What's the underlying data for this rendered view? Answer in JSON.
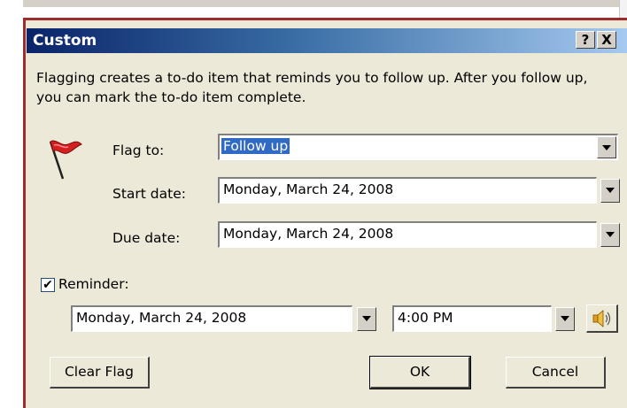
{
  "dialog": {
    "title": "Custom",
    "help_button": "?",
    "close_button": "X",
    "description": "Flagging creates a to-do item that reminds you to follow up. After you follow up, you can mark the to-do item complete."
  },
  "fields": {
    "flag_to": {
      "label": "Flag to:",
      "value": "Follow up"
    },
    "start_date": {
      "label": "Start date:",
      "value": "Monday, March 24, 2008"
    },
    "due_date": {
      "label": "Due date:",
      "value": "Monday, March 24, 2008"
    }
  },
  "reminder": {
    "label": "Reminder:",
    "checked": "✔",
    "date": "Monday, March 24, 2008",
    "time": "4:00 PM"
  },
  "buttons": {
    "clear_flag": "Clear Flag",
    "ok": "OK",
    "cancel": "Cancel"
  },
  "icons": {
    "flag": "red-flag-icon",
    "sound": "speaker-icon",
    "dropdown": "chevron-down-icon"
  },
  "colors": {
    "titlebar_start": "#0a246a",
    "titlebar_end": "#a6caf0",
    "dialog_bg": "#ece9d8",
    "flag_red": "#d42020",
    "selection": "#316ac5"
  }
}
